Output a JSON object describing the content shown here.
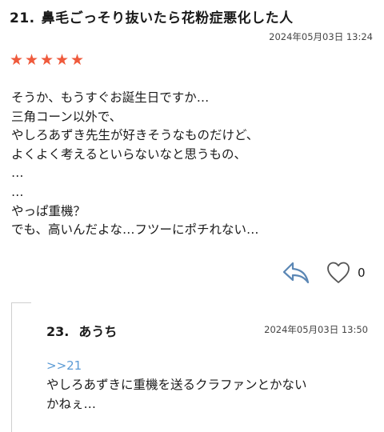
{
  "comment": {
    "number": "21.",
    "author": "鼻毛ごっそり抜いたら花粉症悪化した人",
    "date": "2024年05月03日 13:24",
    "rating": 5,
    "lines": [
      "そうか、もうすぐお誕生日ですか…",
      "三角コーン以外で、",
      "やしろあずき先生が好きそうなものだけど、",
      "よくよく考えるといらないなと思うもの、",
      "…",
      "…",
      "やっぱ重機？",
      "でも、高いんだよな…フツーにポチれない…"
    ],
    "like_count": "0",
    "colors": {
      "star": "#ef5a3c",
      "icon": "#5b87b5"
    },
    "icons": {
      "reply": "reply-arrow-icon",
      "like": "heart-outline-icon"
    }
  },
  "reply": {
    "number": "23.",
    "author": "あうち",
    "date": "2024年05月03日 13:50",
    "anchor": ">>21",
    "lines": [
      "やしろあずきに重機を送るクラファンとかない",
      "かねぇ…"
    ],
    "colors": {
      "anchor": "#5b9bd5"
    }
  }
}
